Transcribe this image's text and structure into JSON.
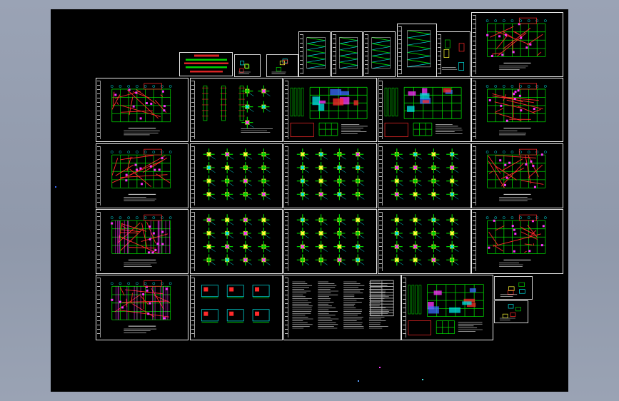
{
  "window": {
    "background": "#969fb1",
    "canvas_color": "#000000"
  },
  "colors": {
    "frame": "#e8e8e8",
    "grid": "#00d000",
    "wall": "#ff2a2a",
    "axis": "#00e5e5",
    "member": "#ffff33",
    "hatch": "#ff33ff",
    "blue": "#3a6cff",
    "note": "#e0e0e0"
  },
  "legend_sign": {
    "icon": "legend-sign-icon",
    "lines": [
      "",
      "",
      "",
      "",
      ""
    ]
  },
  "sheets": [
    {
      "id": "s01",
      "kind": "detail"
    },
    {
      "id": "s02",
      "kind": "detail"
    },
    {
      "id": "s03",
      "kind": "stair"
    },
    {
      "id": "s04",
      "kind": "stair"
    },
    {
      "id": "s05",
      "kind": "stair"
    },
    {
      "id": "s06",
      "kind": "stair"
    },
    {
      "id": "s07",
      "kind": "detail"
    },
    {
      "id": "s08",
      "kind": "plan"
    },
    {
      "id": "s09",
      "kind": "plan"
    },
    {
      "id": "s10",
      "kind": "elevation"
    },
    {
      "id": "s11",
      "kind": "color-plan"
    },
    {
      "id": "s12",
      "kind": "color-plan"
    },
    {
      "id": "s13",
      "kind": "plan"
    },
    {
      "id": "s14",
      "kind": "plan"
    },
    {
      "id": "s15",
      "kind": "nodes"
    },
    {
      "id": "s16",
      "kind": "nodes"
    },
    {
      "id": "s17",
      "kind": "nodes"
    },
    {
      "id": "s18",
      "kind": "plan"
    },
    {
      "id": "s19",
      "kind": "rebar-plan"
    },
    {
      "id": "s20",
      "kind": "nodes"
    },
    {
      "id": "s21",
      "kind": "nodes"
    },
    {
      "id": "s22",
      "kind": "nodes"
    },
    {
      "id": "s23",
      "kind": "plan"
    },
    {
      "id": "s24",
      "kind": "rebar-plan"
    },
    {
      "id": "s25",
      "kind": "sections"
    },
    {
      "id": "s26",
      "kind": "notes"
    },
    {
      "id": "s27",
      "kind": "color-plan"
    },
    {
      "id": "s28",
      "kind": "detail"
    },
    {
      "id": "s29",
      "kind": "detail"
    }
  ]
}
